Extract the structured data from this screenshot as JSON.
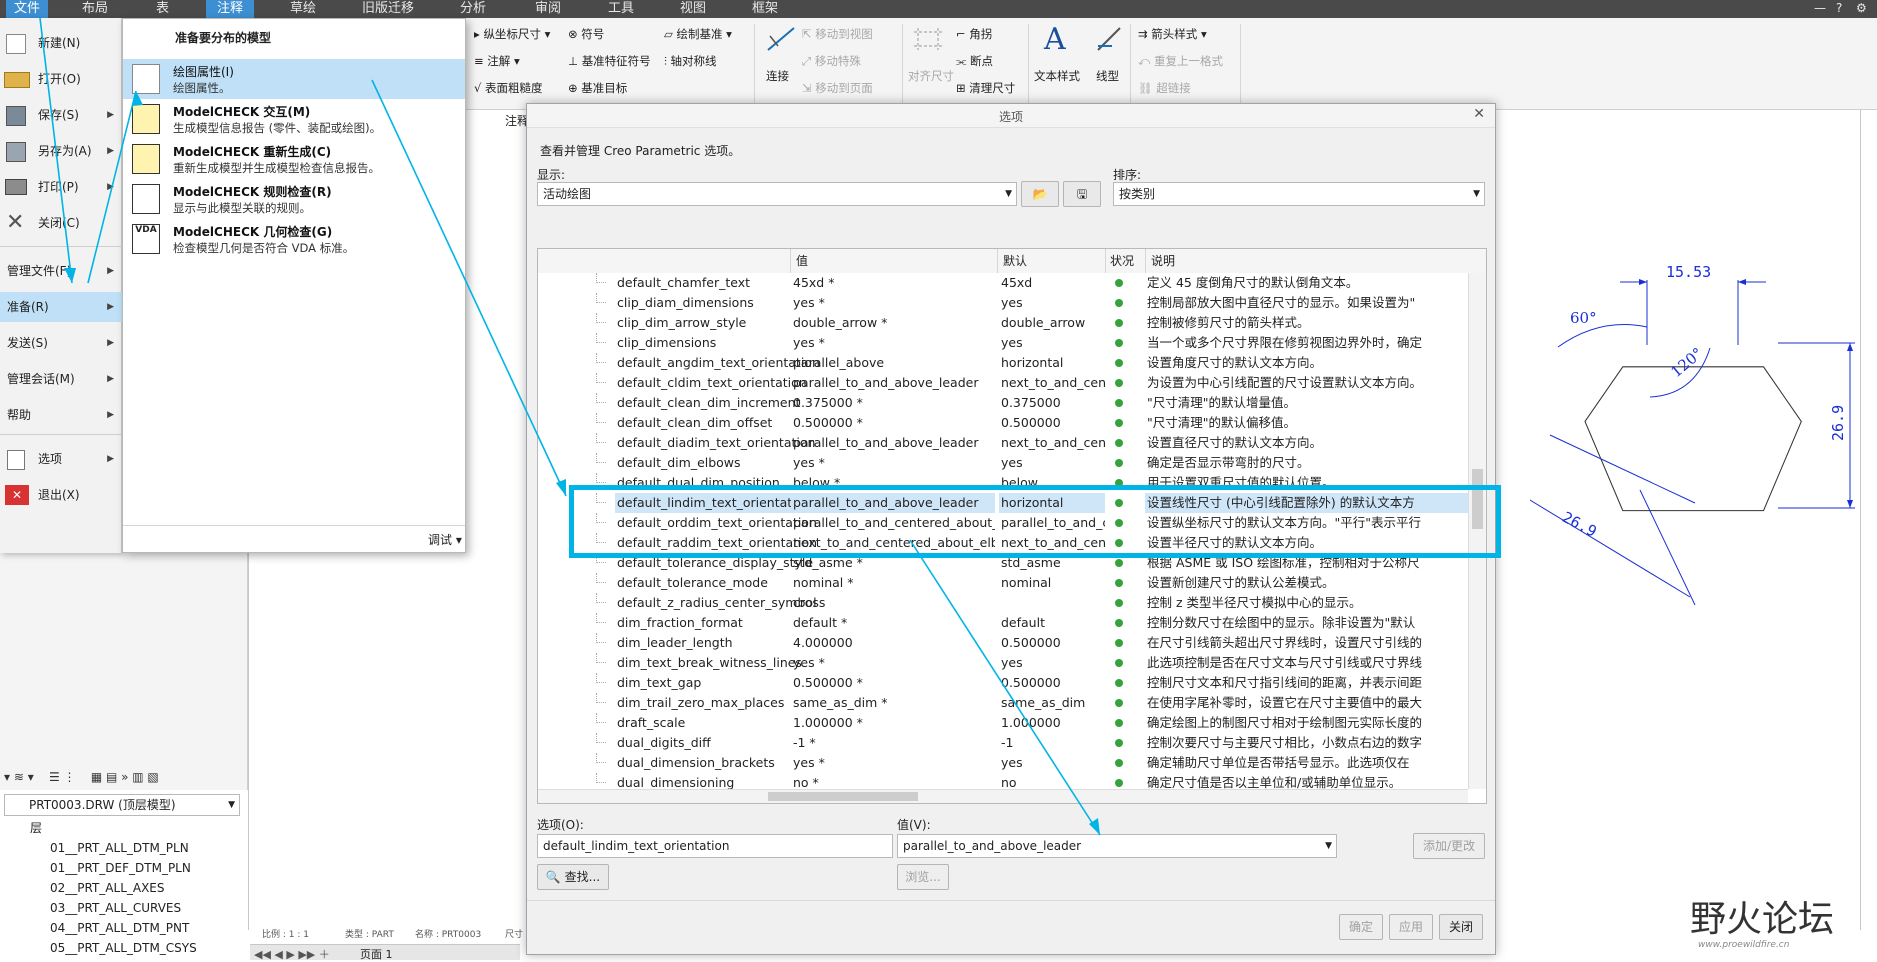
{
  "menubar": {
    "tabs": [
      "文件",
      "布局",
      "表",
      "注释",
      "草绘",
      "旧版迁移",
      "分析",
      "审阅",
      "工具",
      "视图",
      "框架"
    ]
  },
  "ribbon": {
    "g1": {
      "ord_dim": "纵坐标尺寸",
      "symbol": "符号",
      "draw_datum": "绘制基准",
      "note": "注解",
      "datum_feature": "基准特征符号",
      "axis_sym": "轴对称线",
      "surface_finish": "表面粗糙度",
      "datum_target": "基准目标"
    },
    "connect": "连接",
    "g2": {
      "move_to_view": "移动到视图",
      "move_special": "移动特殊",
      "move_to_page": "移动到页面"
    },
    "g3": {
      "align_dim": "对齐尺寸",
      "corner": "角拐",
      "breakpoint": "断点",
      "cleanup_dim": "清理尺寸"
    },
    "text_style": "文本样式",
    "line_style": "线型",
    "g4": {
      "arrow_style": "箭头样式",
      "repeat_format": "重复上一格式",
      "hyperlink": "超链接"
    },
    "annot_tab": "注释"
  },
  "file_menu": {
    "items": [
      {
        "label": "新建(N)",
        "arrow": false
      },
      {
        "label": "打开(O)",
        "arrow": false
      },
      {
        "label": "保存(S)",
        "arrow": true
      },
      {
        "label": "另存为(A)",
        "arrow": true
      },
      {
        "label": "打印(P)",
        "arrow": true
      },
      {
        "label": "关闭(C)",
        "arrow": false
      },
      {
        "label": "管理文件(F)",
        "arrow": true
      },
      {
        "label": "准备(R)",
        "arrow": true
      },
      {
        "label": "发送(S)",
        "arrow": true
      },
      {
        "label": "管理会话(M)",
        "arrow": true
      },
      {
        "label": "帮助",
        "arrow": true
      },
      {
        "label": "选项",
        "arrow": true
      },
      {
        "label": "退出(X)",
        "arrow": false
      }
    ]
  },
  "submenu": {
    "header": "准备要分布的模型",
    "items": [
      {
        "title": "绘图属性(I)",
        "desc": "绘图属性。"
      },
      {
        "title": "ModelCHECK 交互(M)",
        "desc": "生成模型信息报告 (零件、装配或绘图)。"
      },
      {
        "title": "ModelCHECK 重新生成(C)",
        "desc": "重新生成模型并生成模型检查信息报告。"
      },
      {
        "title": "ModelCHECK 规则检查(R)",
        "desc": "显示与此模型关联的规则。"
      },
      {
        "title": "ModelCHECK 几何检查(G)",
        "desc": "检查模型几何是否符合 VDA 标准。"
      }
    ],
    "vda_label": "VDA",
    "debug": "调试"
  },
  "dialog": {
    "title": "选项",
    "intro": "查看并管理 Creo Parametric 选项。",
    "show_label": "显示:",
    "show_value": "活动绘图",
    "sort_label": "排序:",
    "sort_value": "按类别",
    "columns": [
      "值",
      "默认",
      "状况",
      "说明"
    ],
    "rows": [
      {
        "name": "default_chamfer_text",
        "value": "45xd *",
        "default": "45xd",
        "desc": "定义 45 度倒角尺寸的默认倒角文本。"
      },
      {
        "name": "clip_diam_dimensions",
        "value": "yes *",
        "default": "yes",
        "desc": "控制局部放大图中直径尺寸的显示。如果设置为\""
      },
      {
        "name": "clip_dim_arrow_style",
        "value": "double_arrow *",
        "default": "double_arrow",
        "desc": "控制被修剪尺寸的箭头样式。"
      },
      {
        "name": "clip_dimensions",
        "value": "yes *",
        "default": "yes",
        "desc": "当一个或多个尺寸界限在修剪视图边界外时，确定"
      },
      {
        "name": "default_angdim_text_orientation",
        "value": "parallel_above",
        "default": "horizontal",
        "desc": "设置角度尺寸的默认文本方向。"
      },
      {
        "name": "default_cldim_text_orientation",
        "value": "parallel_to_and_above_leader",
        "default": "next_to_and_centered",
        "desc": "为设置为中心引线配置的尺寸设置默认文本方向。"
      },
      {
        "name": "default_clean_dim_increment",
        "value": "0.375000 *",
        "default": "0.375000",
        "desc": "\"尺寸清理\"的默认增量值。"
      },
      {
        "name": "default_clean_dim_offset",
        "value": "0.500000 *",
        "default": "0.500000",
        "desc": "\"尺寸清理\"的默认偏移值。"
      },
      {
        "name": "default_diadim_text_orientation",
        "value": "parallel_to_and_above_leader",
        "default": "next_to_and_centered",
        "desc": "设置直径尺寸的默认文本方向。"
      },
      {
        "name": "default_dim_elbows",
        "value": "yes *",
        "default": "yes",
        "desc": "确定是否显示带弯肘的尺寸。"
      },
      {
        "name": "default_dual_dim_position",
        "value": "below *",
        "default": "below",
        "desc": "用于设置双重尺寸值的默认位置。"
      },
      {
        "name": "default_lindim_text_orientation",
        "value": "parallel_to_and_above_leader",
        "default": "horizontal",
        "desc": "设置线性尺寸 (中心引线配置除外) 的默认文本方"
      },
      {
        "name": "default_orddim_text_orientation",
        "value": "parallel_to_and_centered_about_leader *",
        "default": "parallel_to_and_center",
        "desc": "设置纵坐标尺寸的默认文本方向。\"平行\"表示平行"
      },
      {
        "name": "default_raddim_text_orientation",
        "value": "next_to_and_centered_about_elbow *",
        "default": "next_to_and_centered",
        "desc": "设置半径尺寸的默认文本方向。"
      },
      {
        "name": "default_tolerance_display_style",
        "value": "std_asme *",
        "default": "std_asme",
        "desc": "根据 ASME 或 ISO 绘图标准，控制相对于公称尺"
      },
      {
        "name": "default_tolerance_mode",
        "value": "nominal *",
        "default": "nominal",
        "desc": "设置新创建尺寸的默认公差模式。"
      },
      {
        "name": "default_z_radius_center_symbol",
        "value": "cross",
        "default": "",
        "desc": "控制 z 类型半径尺寸模拟中心的显示。"
      },
      {
        "name": "dim_fraction_format",
        "value": "default *",
        "default": "default",
        "desc": "控制分数尺寸在绘图中的显示。除非设置为\"默认"
      },
      {
        "name": "dim_leader_length",
        "value": "4.000000",
        "default": "0.500000",
        "desc": "在尺寸引线箭头超出尺寸界线时，设置尺寸引线的"
      },
      {
        "name": "dim_text_break_witness_lines",
        "value": "yes *",
        "default": "yes",
        "desc": "此选项控制是否在尺寸文本与尺寸引线或尺寸界线"
      },
      {
        "name": "dim_text_gap",
        "value": "0.500000 *",
        "default": "0.500000",
        "desc": "控制尺寸文本和尺寸指引线间的距离，并表示间距"
      },
      {
        "name": "dim_trail_zero_max_places",
        "value": "same_as_dim *",
        "default": "same_as_dim",
        "desc": "在使用字尾补零时，设置它在尺寸主要值中的最大"
      },
      {
        "name": "draft_scale",
        "value": "1.000000 *",
        "default": "1.000000",
        "desc": "确定绘图上的制图尺寸相对于绘制图元实际长度的"
      },
      {
        "name": "dual_digits_diff",
        "value": "-1 *",
        "default": "-1",
        "desc": "控制次要尺寸与主要尺寸相比，小数点右边的数字"
      },
      {
        "name": "dual_dimension_brackets",
        "value": "yes *",
        "default": "yes",
        "desc": "确定辅助尺寸单位是否带括号显示。此选项仅在"
      },
      {
        "name": "dual_dimensioning",
        "value": "no *",
        "default": "no",
        "desc": "确定尺寸值是否以主单位和/或辅助单位显示。"
      }
    ],
    "option_label": "选项(O):",
    "option_value": "default_lindim_text_orientation",
    "value_label": "值(V):",
    "value_value": "parallel_to_and_above_leader",
    "find_btn": "查找...",
    "browse_btn": "浏览...",
    "addchange_btn": "添加/更改",
    "ok_btn": "确定",
    "apply_btn": "应用",
    "close_btn": "关闭"
  },
  "drawing": {
    "dim_top": "15.53",
    "angle_60": "60°",
    "angle_120": "120°",
    "dim_right": "26.9",
    "dim_bottom": "26.9"
  },
  "tree": {
    "model": "PRT0003.DRW (顶层模型)",
    "layer_header": "层",
    "layers": [
      "01__PRT_ALL_DTM_PLN",
      "01__PRT_DEF_DTM_PLN",
      "02__PRT_ALL_AXES",
      "03__PRT_ALL_CURVES",
      "04__PRT_ALL_DTM_PNT",
      "05__PRT_ALL_DTM_CSYS"
    ]
  },
  "statusbar": {
    "scale": "比例 :  1 : 1",
    "type": "类型 :  PART",
    "name": "名称 :  PRT0003",
    "size": "尺寸 :",
    "page": "页面 1"
  },
  "watermark": {
    "text": "野火论坛",
    "url": "www.proewildfire.cn"
  },
  "colors": {
    "accent": "#00b4e6",
    "selected_menu": "#bfe0f6",
    "status_ok": "#33a33a",
    "tab_active": "#3d8fd1",
    "dim_blue": "#1a2fd6"
  }
}
